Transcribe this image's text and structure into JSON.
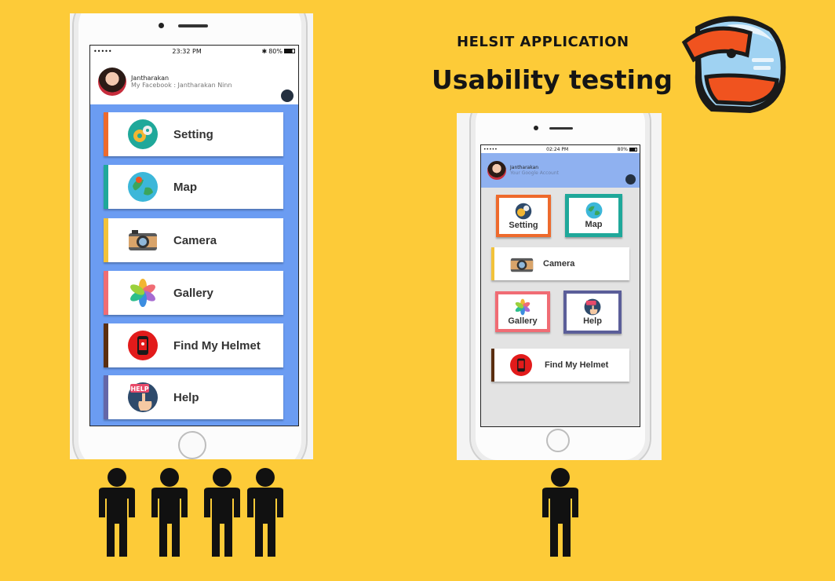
{
  "header": {
    "app_title": "HELSIT APPLICATION",
    "subtitle": "Usability testing"
  },
  "phone_a": {
    "status": {
      "carrier": "•••••",
      "time": "23:32 PM",
      "battery": "80%"
    },
    "profile": {
      "name": "Jantharakan",
      "account": "My Facebook : Jantharakan Ninn"
    },
    "menu": [
      {
        "label": "Setting",
        "icon": "gears-icon",
        "bar_color": "#EE6A2C"
      },
      {
        "label": "Map",
        "icon": "globe-icon",
        "bar_color": "#1FA89A"
      },
      {
        "label": "Camera",
        "icon": "camera-icon",
        "bar_color": "#F2C23A"
      },
      {
        "label": "Gallery",
        "icon": "photos-flower-icon",
        "bar_color": "#F06C74"
      },
      {
        "label": "Find My Helmet",
        "icon": "helmet-locator-icon",
        "bar_color": "#5A2E10"
      },
      {
        "label": "Help",
        "icon": "help-hand-icon",
        "bar_color": "#6466A8"
      }
    ],
    "panel_color": "#6B9CF2",
    "testers": 4
  },
  "phone_b": {
    "status": {
      "carrier": "•••••",
      "time": "02:24 PM",
      "battery": "80%"
    },
    "profile": {
      "name": "Jantharakan",
      "account": "Your Google Account"
    },
    "tiles": [
      {
        "label": "Setting",
        "icon": "gears-icon",
        "border_color": "#EE6A2C"
      },
      {
        "label": "Map",
        "icon": "globe-icon",
        "border_color": "#1FA89A"
      },
      {
        "label": "Gallery",
        "icon": "photos-flower-icon",
        "border_color": "#F06C74"
      },
      {
        "label": "Help",
        "icon": "help-hand-icon",
        "border_color": "#5B5E99"
      }
    ],
    "rows": [
      {
        "label": "Camera",
        "icon": "camera-icon",
        "bar_color": "#F2C23A"
      },
      {
        "label": "Find My Helmet",
        "icon": "helmet-locator-icon",
        "bar_color": "#5A2E10"
      }
    ],
    "header_color": "#8FB1F0",
    "testers": 1
  },
  "colors": {
    "background": "#FDCB38",
    "figure": "#111111"
  }
}
